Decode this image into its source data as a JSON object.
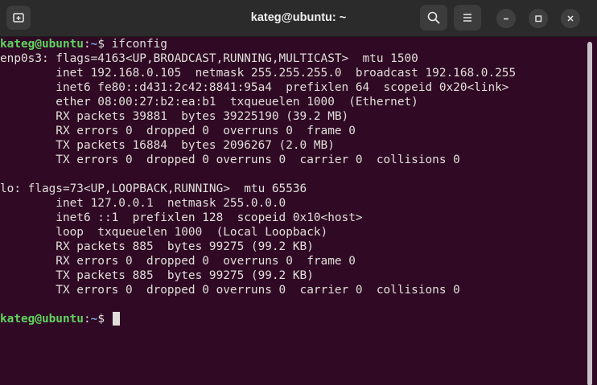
{
  "window": {
    "title": "kateg@ubuntu: ~"
  },
  "titlebar": {
    "new_tab_icon": "new-tab-icon",
    "search_icon": "search-icon",
    "menu_icon": "hamburger-menu-icon",
    "minimize_icon": "minimize-icon",
    "maximize_icon": "maximize-icon",
    "close_icon": "close-icon"
  },
  "colors": {
    "background": "#300a24",
    "prompt_user": "#5fd35f",
    "prompt_path": "#7a9fd9",
    "text": "#e0dedb"
  },
  "terminal": {
    "prompt_user": "kateg@ubuntu",
    "prompt_colon": ":",
    "prompt_path": "~",
    "prompt_symbol": "$ ",
    "command": "ifconfig",
    "output": [
      "enp0s3: flags=4163<UP,BROADCAST,RUNNING,MULTICAST>  mtu 1500",
      "        inet 192.168.0.105  netmask 255.255.255.0  broadcast 192.168.0.255",
      "        inet6 fe80::d431:2c42:8841:95a4  prefixlen 64  scopeid 0x20<link>",
      "        ether 08:00:27:b2:ea:b1  txqueuelen 1000  (Ethernet)",
      "        RX packets 39881  bytes 39225190 (39.2 MB)",
      "        RX errors 0  dropped 0  overruns 0  frame 0",
      "        TX packets 16884  bytes 2096267 (2.0 MB)",
      "        TX errors 0  dropped 0 overruns 0  carrier 0  collisions 0",
      "",
      "lo: flags=73<UP,LOOPBACK,RUNNING>  mtu 65536",
      "        inet 127.0.0.1  netmask 255.0.0.0",
      "        inet6 ::1  prefixlen 128  scopeid 0x10<host>",
      "        loop  txqueuelen 1000  (Local Loopback)",
      "        RX packets 885  bytes 99275 (99.2 KB)",
      "        RX errors 0  dropped 0  overruns 0  frame 0",
      "        TX packets 885  bytes 99275 (99.2 KB)",
      "        TX errors 0  dropped 0 overruns 0  carrier 0  collisions 0",
      ""
    ]
  }
}
